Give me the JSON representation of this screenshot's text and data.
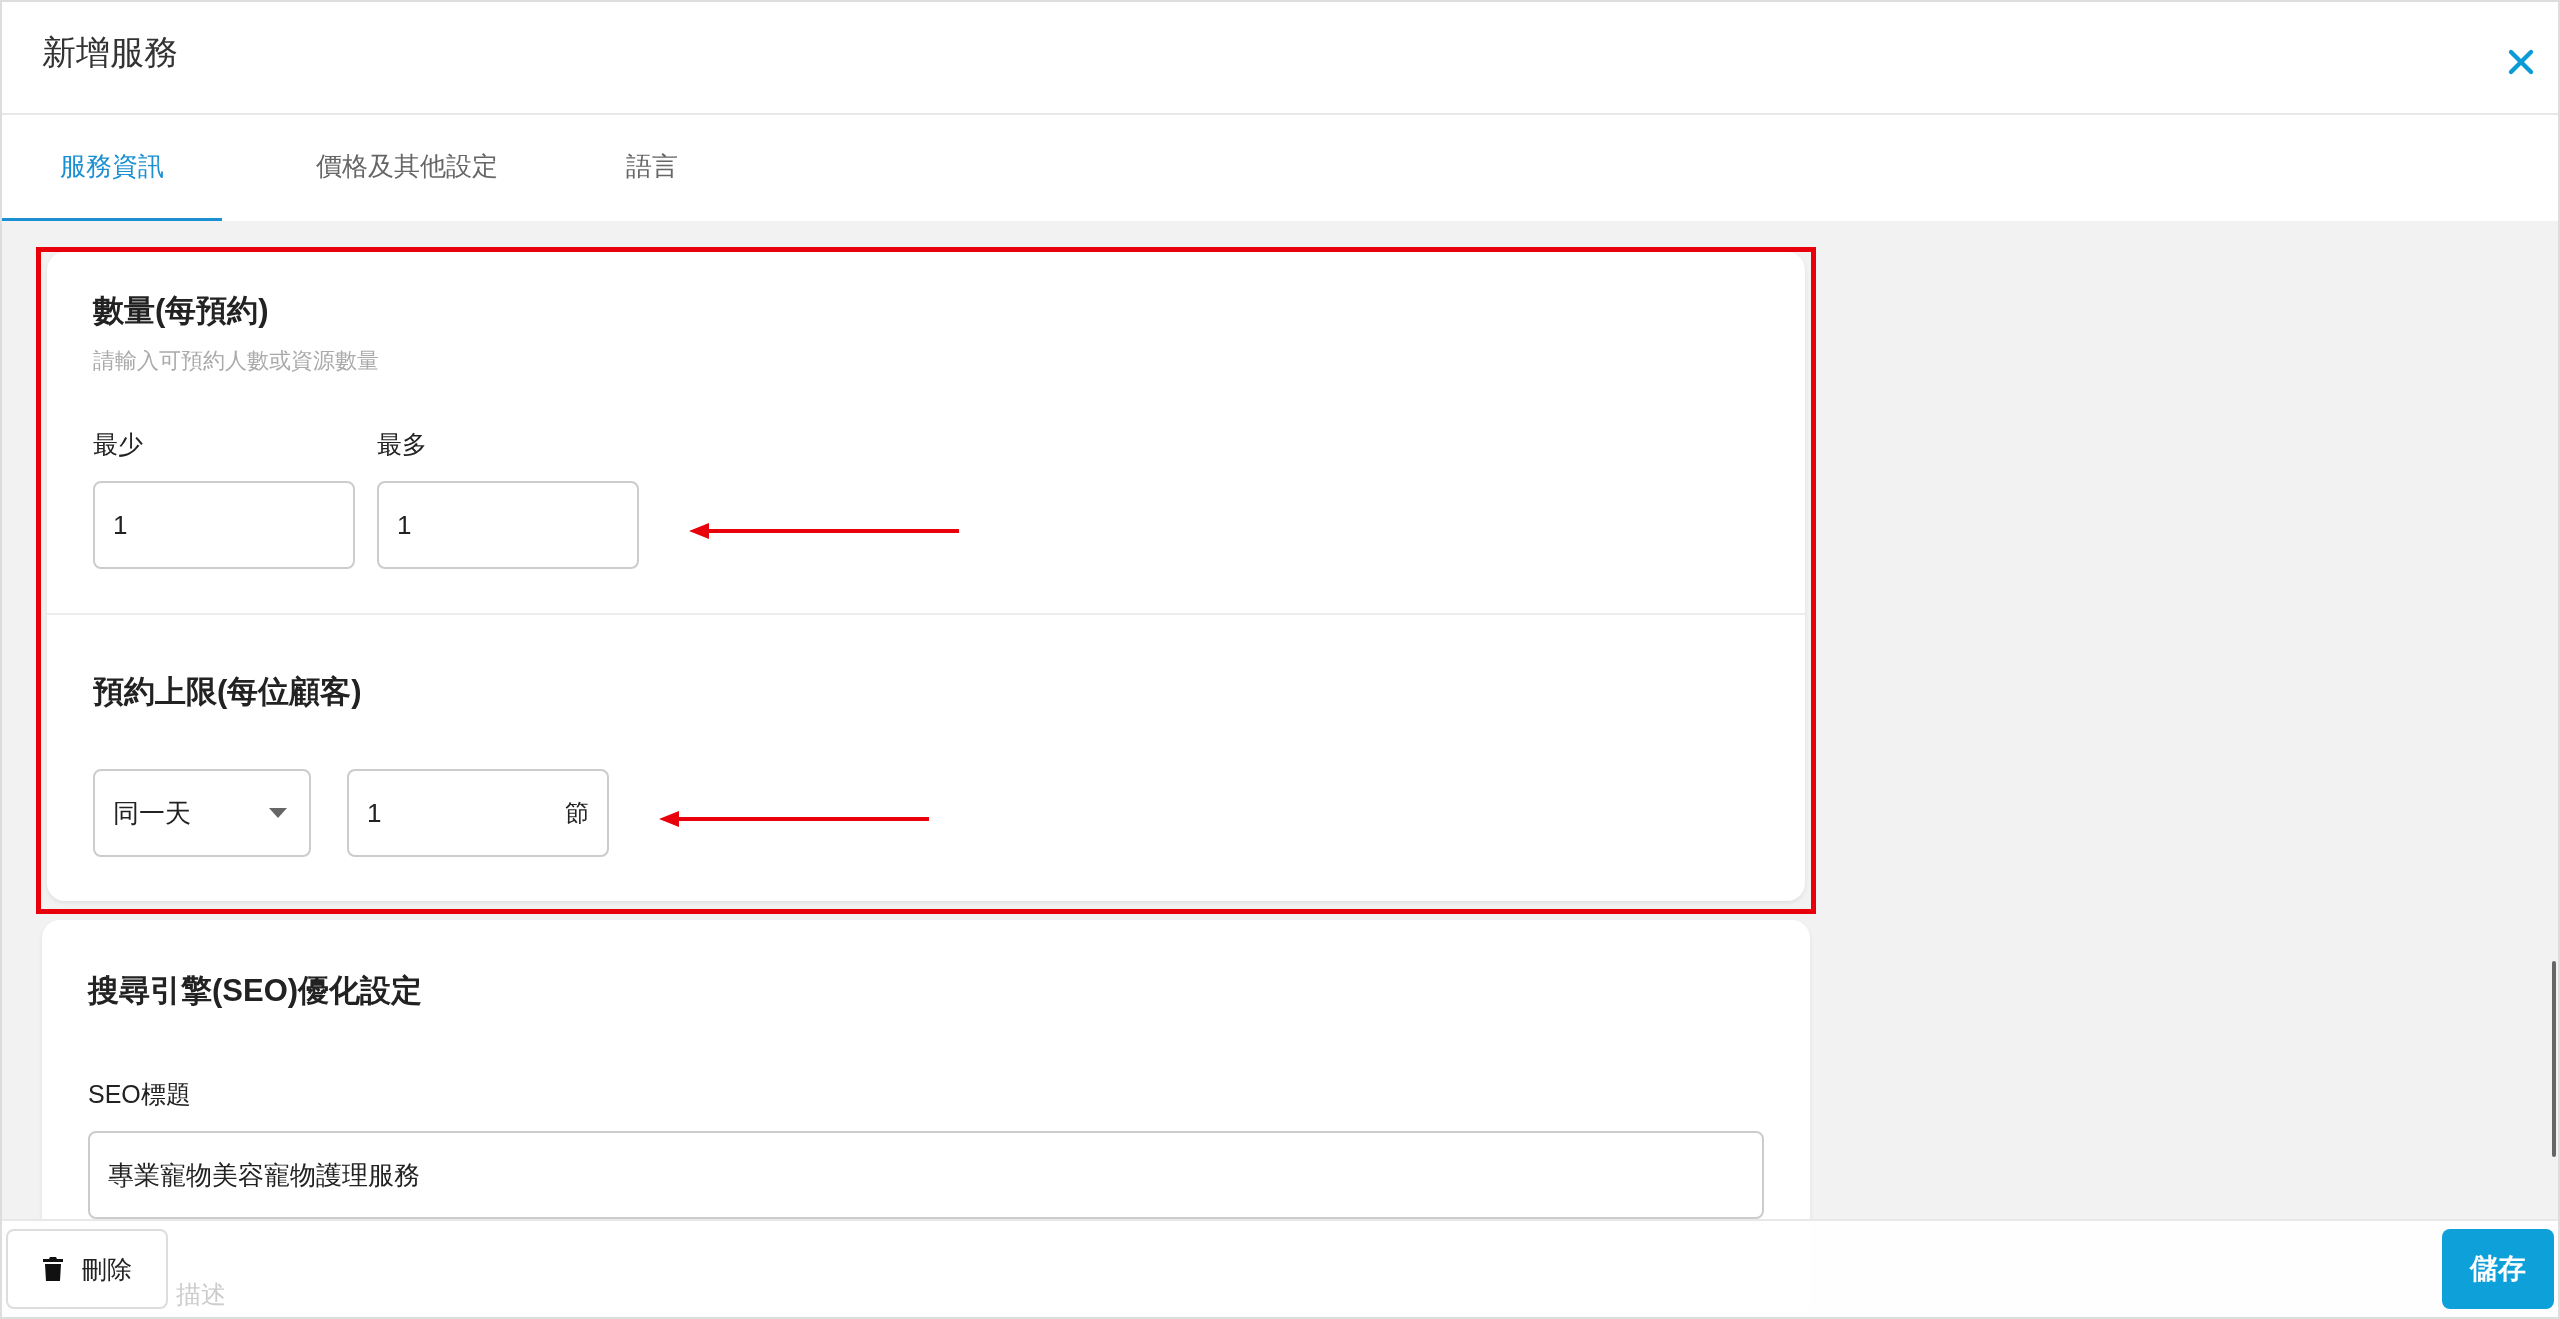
{
  "dialog": {
    "title": "新增服務"
  },
  "tabs": [
    {
      "label": "服務資訊",
      "selected": true
    },
    {
      "label": "價格及其他設定",
      "selected": false
    },
    {
      "label": "語言",
      "selected": false
    }
  ],
  "sections": [
    {
      "title": "數量(每預約)",
      "subtitle": "請輸入可預約人數或資源數量",
      "fields": [
        {
          "kind": "number",
          "label": "最少",
          "value": "1"
        },
        {
          "kind": "number",
          "label": "最多",
          "value": "1"
        }
      ]
    },
    {
      "title": "預約上限(每位顧客)",
      "fields": [
        {
          "kind": "select",
          "value": "同一天"
        },
        {
          "kind": "number",
          "value": "1",
          "suffix": "節"
        }
      ]
    }
  ],
  "seo": {
    "title": "搜尋引擎(SEO)優化設定",
    "fields": [
      {
        "label": "SEO標題",
        "value": "專業寵物美容寵物護理服務"
      }
    ],
    "hidden_label": "描述"
  },
  "footer": {
    "delete_button": "刪除",
    "save_button": "儲存"
  }
}
